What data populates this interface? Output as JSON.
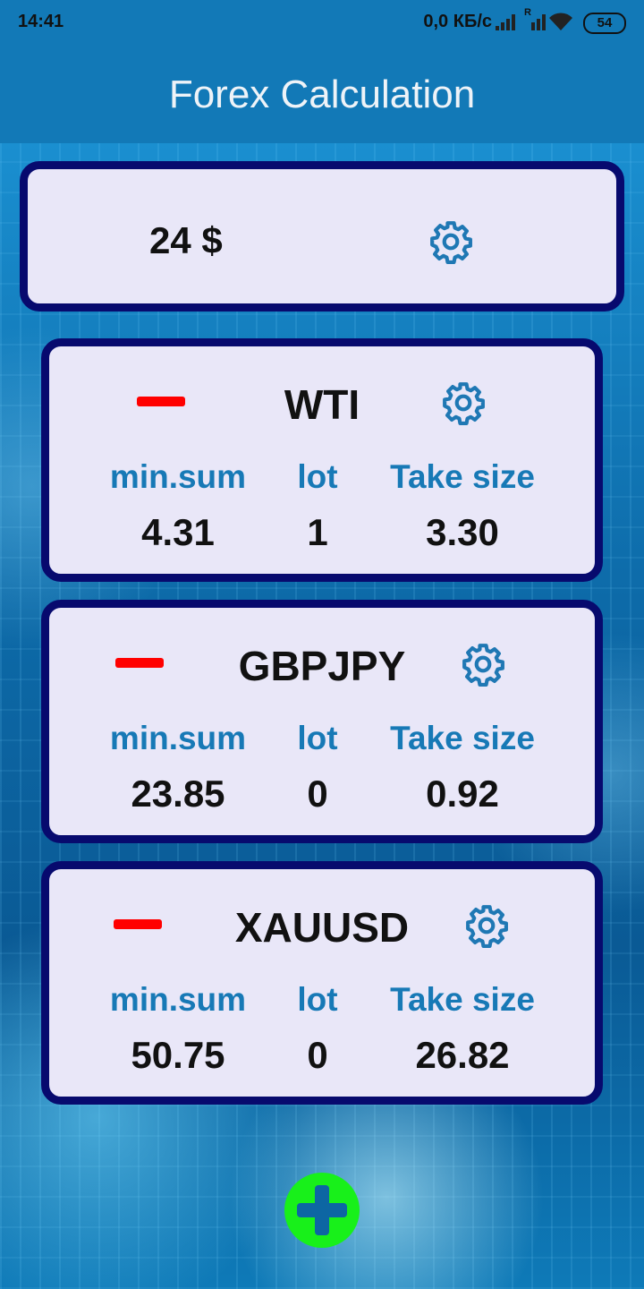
{
  "status_bar": {
    "time": "14:41",
    "network_speed": "0,0 КБ/с",
    "roaming_mark": "R",
    "battery": "54",
    "icons": [
      "signal-icon",
      "roaming-signal-icon",
      "wifi-icon",
      "battery-icon"
    ]
  },
  "app_bar": {
    "title": "Forex Calculation"
  },
  "balance": {
    "value": "24 $",
    "icon": "gear-icon"
  },
  "columns": {
    "min_sum": "min.sum",
    "lot": "lot",
    "take_size": "Take size"
  },
  "pairs": [
    {
      "symbol": "WTI",
      "min_sum": "4.31",
      "lot": "1",
      "take_size": "3.30"
    },
    {
      "symbol": "GBPJPY",
      "min_sum": "23.85",
      "lot": "0",
      "take_size": "0.92"
    },
    {
      "symbol": "XAUUSD",
      "min_sum": "50.75",
      "lot": "0",
      "take_size": "26.82"
    }
  ],
  "colors": {
    "app_bar": "#1279b7",
    "card_background": "#e9e7f8",
    "card_border": "#070a6e",
    "label_blue": "#1779b6",
    "remove_red": "#ff0000",
    "add_green": "#18f01a"
  }
}
